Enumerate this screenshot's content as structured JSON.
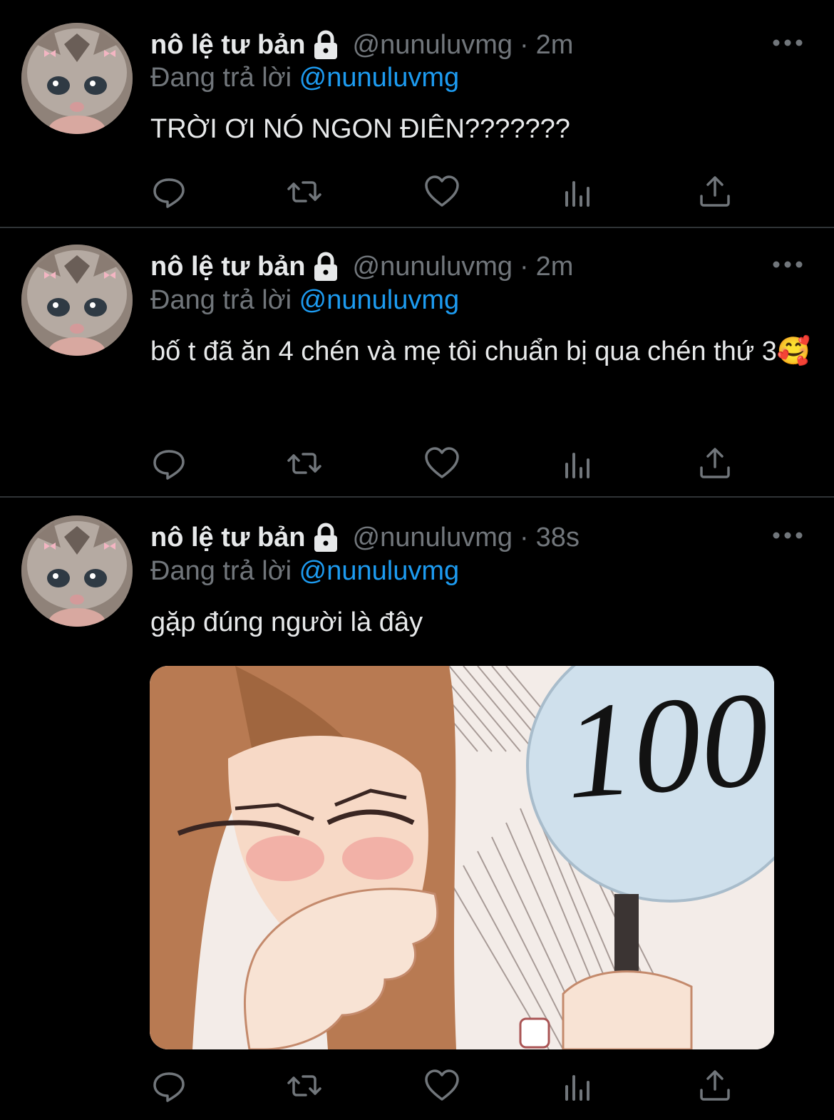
{
  "tweets": [
    {
      "display_name": "nô lệ tư bản",
      "handle": "@nunuluvmg",
      "separator": "·",
      "time": "2m",
      "reply_prefix": "Đang trả lời",
      "reply_to": "@nunuluvmg",
      "text": "TRỜI ƠI NÓ NGON ĐIÊN???????"
    },
    {
      "display_name": "nô lệ tư bản",
      "handle": "@nunuluvmg",
      "separator": "·",
      "time": "2m",
      "reply_prefix": "Đang trả lời",
      "reply_to": "@nunuluvmg",
      "text": "bố t đã ăn 4 chén và mẹ tôi chuẩn bị qua chén thứ 3🥰"
    },
    {
      "display_name": "nô lệ tư bản",
      "handle": "@nunuluvmg",
      "separator": "·",
      "time": "38s",
      "reply_prefix": "Đang trả lời",
      "reply_to": "@nunuluvmg",
      "text": "gặp đúng người là đây",
      "media": {
        "sign_text": "100"
      }
    }
  ],
  "icons": {
    "lock": "lock-icon",
    "more": "more-icon",
    "reply": "reply-icon",
    "retweet": "retweet-icon",
    "like": "like-icon",
    "views": "views-icon",
    "share": "share-icon"
  },
  "colors": {
    "background": "#000000",
    "text": "#e7e9ea",
    "secondary": "#71767b",
    "accent": "#1d9bf0",
    "divider": "#2f3336"
  }
}
